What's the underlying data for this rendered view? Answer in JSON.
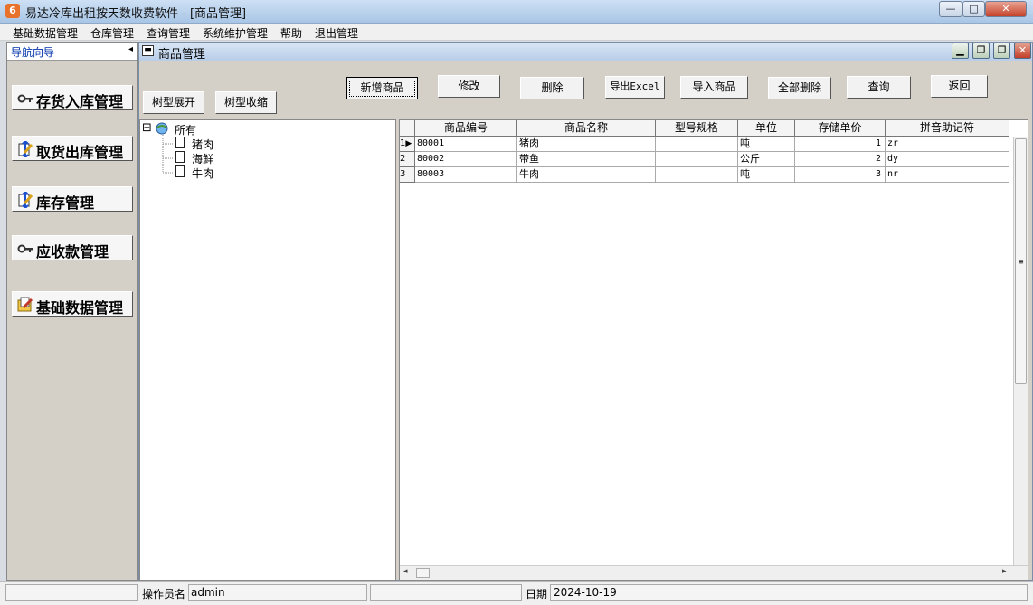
{
  "window": {
    "title": "易达冷库出租按天数收费软件  - [商品管理]",
    "icon_label": "6",
    "min_label": "—",
    "max_label": "□",
    "close_label": "✕"
  },
  "menu": [
    "基础数据管理",
    "仓库管理",
    "查询管理",
    "系统维护管理",
    "帮助",
    "退出管理"
  ],
  "nav": {
    "header": "导航向导",
    "collapse_arrow": "◂",
    "items": [
      {
        "label": "存货入库管理",
        "icon": "key-icon"
      },
      {
        "label": "取货出库管理",
        "icon": "pencil-notebook-icon"
      },
      {
        "label": "库存管理",
        "icon": "pencil-notebook-icon"
      },
      {
        "label": "应收款管理",
        "icon": "key-icon"
      },
      {
        "label": "基础数据管理",
        "icon": "folder-pencil-icon"
      }
    ]
  },
  "child_window": {
    "title": "商品管理",
    "minimize_label": "▁",
    "restore_label": "❐",
    "close_label": "✕"
  },
  "toolbar": {
    "tree_expand": "树型展开",
    "tree_collapse": "树型收缩",
    "add": "新增商品",
    "edit": "修改",
    "delete": "删除",
    "export": "导出Excel",
    "import": "导入商品",
    "delete_all": "全部删除",
    "query": "查询",
    "back": "返回"
  },
  "tree": {
    "root_toggle": "⊟",
    "root": "所有",
    "children": [
      "猪肉",
      "海鲜",
      "牛肉"
    ]
  },
  "grid": {
    "columns": [
      "商品编号",
      "商品名称",
      "型号规格",
      "单位",
      "存储单价",
      "拼音助记符"
    ],
    "rows": [
      {
        "idx": "1",
        "code": "80001",
        "name": "猪肉",
        "spec": "",
        "unit": "吨",
        "price": "1",
        "pinyin": "zr"
      },
      {
        "idx": "2",
        "code": "80002",
        "name": "带鱼",
        "spec": "",
        "unit": "公斤",
        "price": "2",
        "pinyin": "dy"
      },
      {
        "idx": "3",
        "code": "80003",
        "name": "牛肉",
        "spec": "",
        "unit": "吨",
        "price": "3",
        "pinyin": "nr"
      }
    ],
    "current_row_marker": "▶",
    "scroll_left": "◂",
    "scroll_right": "▸",
    "vthumb_grip": "≡"
  },
  "status": {
    "operator_label": "操作员名",
    "operator_value": "admin",
    "date_label": "日期",
    "date_value": "2024-10-19"
  }
}
